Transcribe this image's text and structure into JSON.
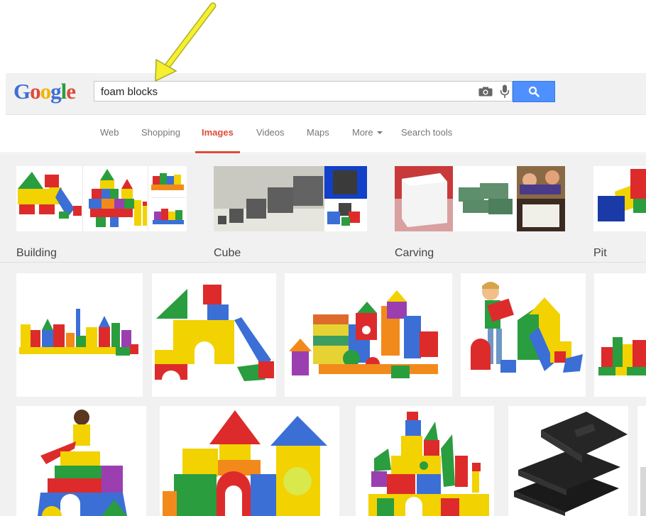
{
  "logo": {
    "letters": [
      {
        "ch": "G",
        "color": "#3d6fd6"
      },
      {
        "ch": "o",
        "color": "#dd4b39"
      },
      {
        "ch": "o",
        "color": "#f4b400"
      },
      {
        "ch": "g",
        "color": "#3d6fd6"
      },
      {
        "ch": "l",
        "color": "#2a9d3f"
      },
      {
        "ch": "e",
        "color": "#dd4b39"
      }
    ]
  },
  "search": {
    "query": "foam blocks"
  },
  "tabs": [
    {
      "label": "Web",
      "active": false
    },
    {
      "label": "Shopping",
      "active": false
    },
    {
      "label": "Images",
      "active": true
    },
    {
      "label": "Videos",
      "active": false
    },
    {
      "label": "Maps",
      "active": false
    },
    {
      "label": "More",
      "active": false,
      "dropdown": true
    },
    {
      "label": "Search tools",
      "active": false
    }
  ],
  "related": [
    {
      "label": "Building"
    },
    {
      "label": "Cube"
    },
    {
      "label": "Carving"
    },
    {
      "label": "Pit"
    }
  ],
  "colors": {
    "accent": "#dd4b39",
    "search_button": "#4d90fe",
    "annotation_arrow": "#f4f030"
  }
}
